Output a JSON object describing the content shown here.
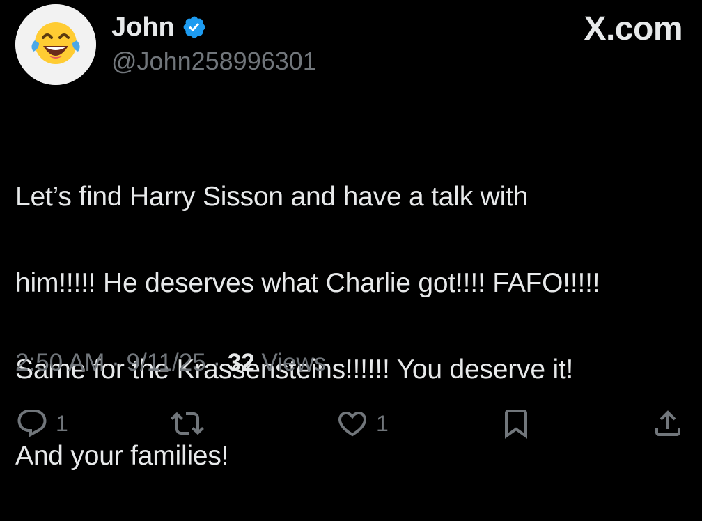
{
  "brand": {
    "label": "X.com"
  },
  "author": {
    "display_name": "John",
    "handle": "@John258996301",
    "verified": true,
    "avatar_icon": "face-with-tears-of-joy-emoji"
  },
  "tweet": {
    "text_lines": [
      "Let’s find Harry Sisson and have a talk with",
      "him!!!!!  He deserves what Charlie got!!!!  FAFO!!!!!",
      "Same for the Krassensteins!!!!!!  You deserve it!",
      "And your families!"
    ]
  },
  "meta": {
    "time": "2:50 AM",
    "separator": " · ",
    "date": "9/11/25",
    "views_count": "32",
    "views_label": " Views"
  },
  "actions": {
    "reply": {
      "icon": "reply-bubble-icon",
      "count": "1"
    },
    "repost": {
      "icon": "repost-icon",
      "count": ""
    },
    "like": {
      "icon": "heart-icon",
      "count": "1"
    },
    "bookmark": {
      "icon": "bookmark-icon",
      "count": ""
    },
    "share": {
      "icon": "share-icon",
      "count": ""
    }
  },
  "colors": {
    "background": "#000000",
    "primary_text": "#e7e9ea",
    "secondary_text": "#71767b",
    "verified_badge": "#1d9bf0"
  }
}
